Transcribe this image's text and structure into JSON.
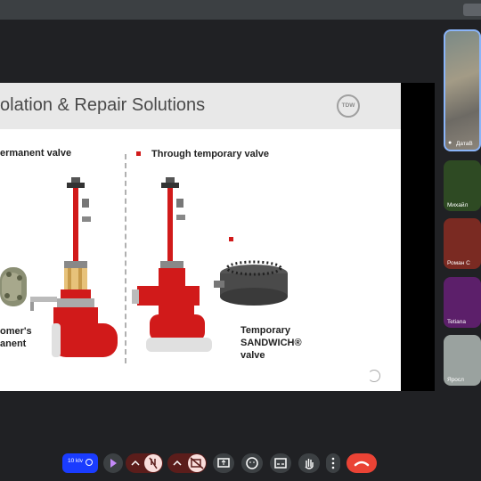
{
  "slide": {
    "title": "olation & Repair Solutions",
    "logo_text": "TDW",
    "left_heading": "ermanent valve",
    "right_heading": "Through temporary valve",
    "left_caption_1": "omer's",
    "left_caption_2": "anent",
    "right_caption_1": "Temporary",
    "right_caption_2": "SANDWICH®",
    "right_caption_3": "valve"
  },
  "participants": [
    {
      "name": "ДатаВ",
      "color": "#7b8a86"
    },
    {
      "name": "Михайл",
      "color": "#2e4a23"
    },
    {
      "name": "Роман С",
      "color": "#7a2a22"
    },
    {
      "name": "Tetiana",
      "color": "#5c1f6a"
    },
    {
      "name": "Яросл",
      "color": "#9aa29f"
    }
  ],
  "controls": {
    "badge": "10 klv",
    "colors": {
      "red": "#ea4335",
      "dark_red": "#5b1d1b",
      "blue": "#1a3cff",
      "gray": "#3c4043"
    }
  }
}
